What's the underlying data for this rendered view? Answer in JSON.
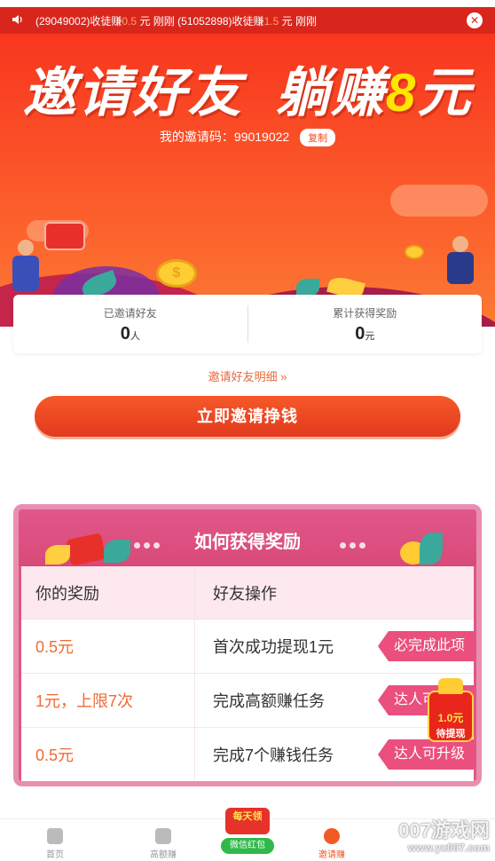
{
  "ticker": {
    "id1": "(29049002)",
    "verb": "收徒赚",
    "amt1": "0.5",
    "unit": "元",
    "time": "刚刚",
    "id2": "(51052898)",
    "amt2": "1.5"
  },
  "hero": {
    "title_a": "邀请好友",
    "title_b": "躺赚",
    "title_amount": "8",
    "title_unit": "元",
    "invite_code_label": "我的邀请码：",
    "invite_code": "99019022",
    "copy_label": "复制"
  },
  "stats": {
    "invited_label": "已邀请好友",
    "invited_value": "0",
    "invited_unit": "人",
    "earned_label": "累计获得奖励",
    "earned_value": "0",
    "earned_unit": "元"
  },
  "detail_link": "邀请好友明细 »",
  "cta_label": "立即邀请挣钱",
  "reward": {
    "title": "如何获得奖励",
    "header_left": "你的奖励",
    "header_right": "好友操作",
    "rows": [
      {
        "reward": "0.5元",
        "action": "首次成功提现1元",
        "tag": "必完成此项"
      },
      {
        "reward": "1元，上限7次",
        "action": "完成高额赚任务",
        "tag": "达人可升级"
      },
      {
        "reward": "0.5元",
        "action": "完成7个赚钱任务",
        "tag": "达人可升级"
      }
    ]
  },
  "float_badge": {
    "amount": "1.0元",
    "label": "待提现"
  },
  "tabbar": {
    "home": "首页",
    "high": "高额赚",
    "center_top": "每天领",
    "center_btn": "微信红包",
    "invite": "邀请赚"
  },
  "watermark": {
    "main": "007游戏网",
    "sub": "www.yx007.com"
  },
  "colors": {
    "primary": "#f24a23",
    "accent_yellow": "#ffe600",
    "pink": "#e25684",
    "reward_orange": "#f06a35"
  }
}
